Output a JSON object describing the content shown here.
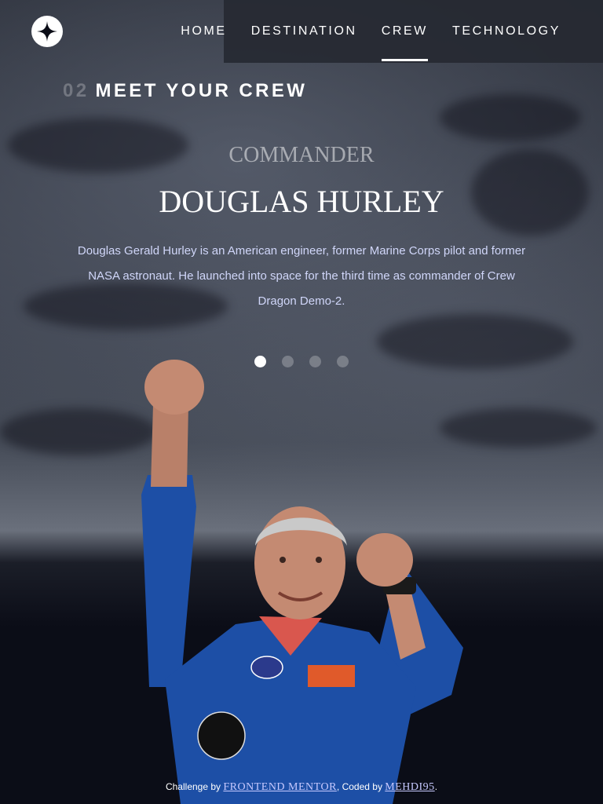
{
  "header": {
    "logo_name": "star-logo-icon",
    "nav": [
      {
        "label": "HOME",
        "active": false
      },
      {
        "label": "DESTINATION",
        "active": false
      },
      {
        "label": "CREW",
        "active": true
      },
      {
        "label": "TECHNOLOGY",
        "active": false
      }
    ]
  },
  "page": {
    "number": "02",
    "title": "MEET YOUR CREW"
  },
  "crew": {
    "role": "COMMANDER",
    "name": "DOUGLAS HURLEY",
    "bio": "Douglas Gerald Hurley is an American engineer, former Marine Corps pilot and former NASA astronaut. He launched into space for the third time as commander of Crew Dragon Demo-2.",
    "slides_total": 4,
    "active_slide": 1
  },
  "footer": {
    "challenge_prefix": "Challenge by",
    "challenge_link": "FRONTEND MENTOR",
    "coded_prefix": ", Coded by",
    "coder_link": "MEHDI95",
    "suffix": "."
  },
  "colors": {
    "accent": "#ffffff",
    "bio_text": "#d0d6f9",
    "link": "#c7c9ff",
    "nav_bg": "#262932",
    "suit": "#1d4fa6"
  }
}
